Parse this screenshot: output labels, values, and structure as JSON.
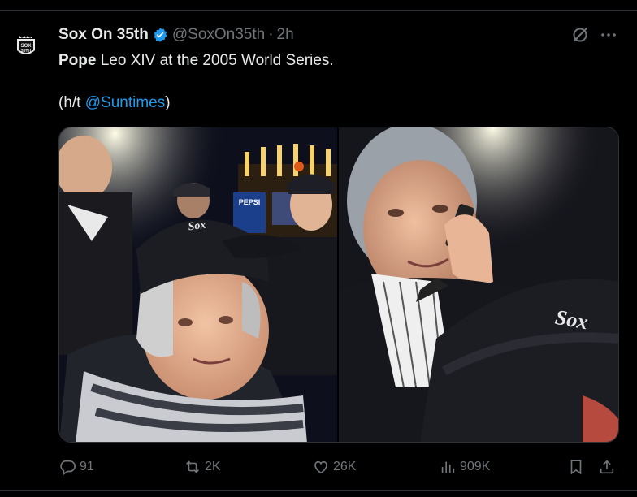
{
  "author": {
    "display_name": "Sox On 35th",
    "handle": "@SoxOn35th",
    "separator": "·",
    "time": "2h",
    "verified": true,
    "avatar_logo_text": "SOX 35TH"
  },
  "tweet": {
    "line1_bold": "Pope",
    "line1_rest": " Leo XIV at the 2005 World Series.",
    "line2_prefix": "(h/t ",
    "line2_mention": "@Suntimes",
    "line2_suffix": ")"
  },
  "media": {
    "left_photo_sign_text": "PEPSI",
    "cap_logo_text": "Sox"
  },
  "actions": {
    "replies": "91",
    "reposts": "2K",
    "likes": "26K",
    "views": "909K"
  },
  "colors": {
    "background": "#000000",
    "text": "#e7e9ea",
    "muted": "#71767b",
    "link": "#1d9bf0",
    "border": "#2f3336"
  },
  "icons": [
    "verified-badge-icon",
    "grok-icon",
    "more-icon",
    "reply-icon",
    "repost-icon",
    "like-icon",
    "views-icon",
    "bookmark-icon",
    "share-icon"
  ]
}
